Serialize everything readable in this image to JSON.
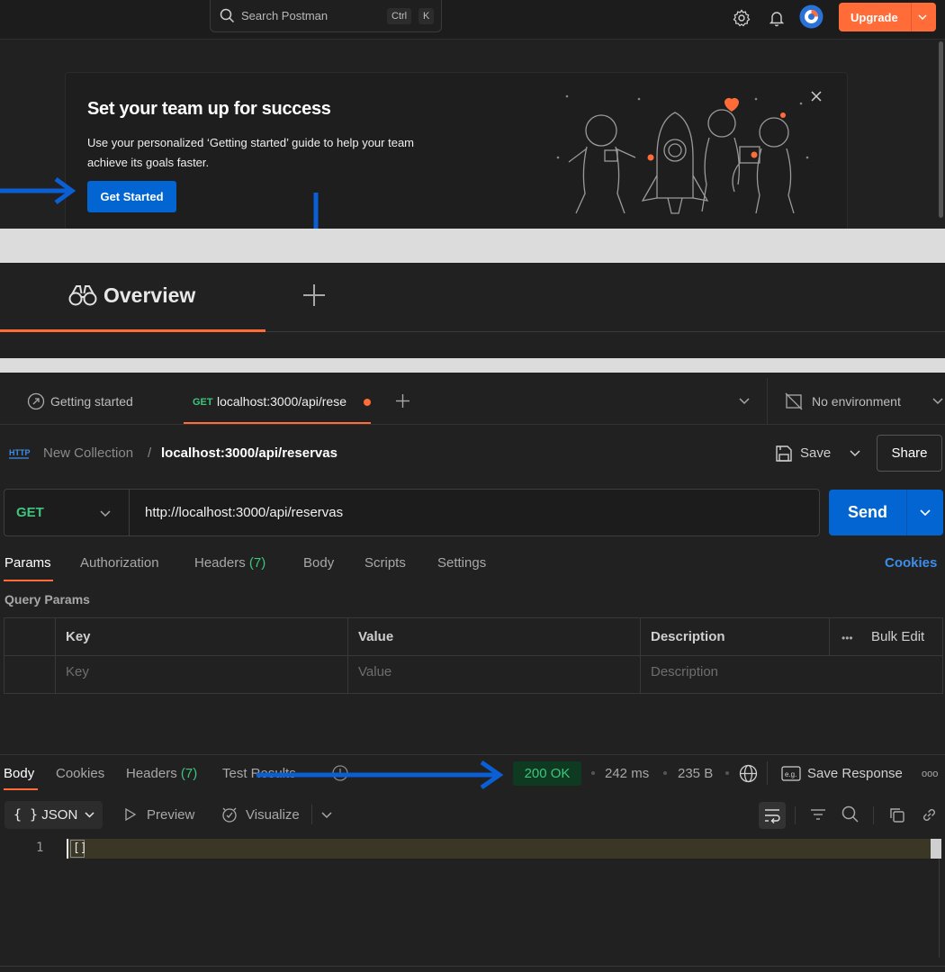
{
  "topbar": {
    "search_placeholder": "Search Postman",
    "shortcut_ctrl": "Ctrl",
    "shortcut_k": "K",
    "upgrade_label": "Upgrade"
  },
  "banner": {
    "title": "Set your team up for success",
    "text": "Use your personalized ‘Getting started’ guide to help your team achieve its goals faster.",
    "cta_label": "Get Started"
  },
  "overview": {
    "tab_label": "Overview"
  },
  "tabs": {
    "getting_started": "Getting started",
    "active_method": "GET",
    "active_label": "localhost:3000/api/rese",
    "environment": "No environment"
  },
  "breadcrumb": {
    "collection": "New Collection",
    "separator": "/",
    "request": "localhost:3000/api/reservas",
    "save_label": "Save",
    "share_label": "Share"
  },
  "request": {
    "method": "GET",
    "url": "http://localhost:3000/api/reservas",
    "send_label": "Send",
    "tabs": {
      "params": "Params",
      "authorization": "Authorization",
      "headers": "Headers",
      "headers_count": "(7)",
      "body": "Body",
      "scripts": "Scripts",
      "settings": "Settings",
      "cookies": "Cookies"
    },
    "query_params_title": "Query Params",
    "table": {
      "headers": [
        "Key",
        "Value",
        "Description"
      ],
      "bulk_edit": "Bulk Edit",
      "placeholders": [
        "Key",
        "Value",
        "Description"
      ]
    }
  },
  "response": {
    "tabs": {
      "body": "Body",
      "cookies": "Cookies",
      "headers": "Headers",
      "headers_count": "(7)",
      "test_results": "Test Results"
    },
    "status": "200 OK",
    "time": "242 ms",
    "size": "235 B",
    "save_response": "Save Response",
    "format": "JSON",
    "preview": "Preview",
    "visualize": "Visualize",
    "line_number": "1",
    "body": "[]"
  },
  "colors": {
    "accent_orange": "#ff6c37",
    "primary_blue": "#0265d2",
    "success_green": "#3ec57b",
    "annotation_arrow": "#0a5fd4"
  }
}
